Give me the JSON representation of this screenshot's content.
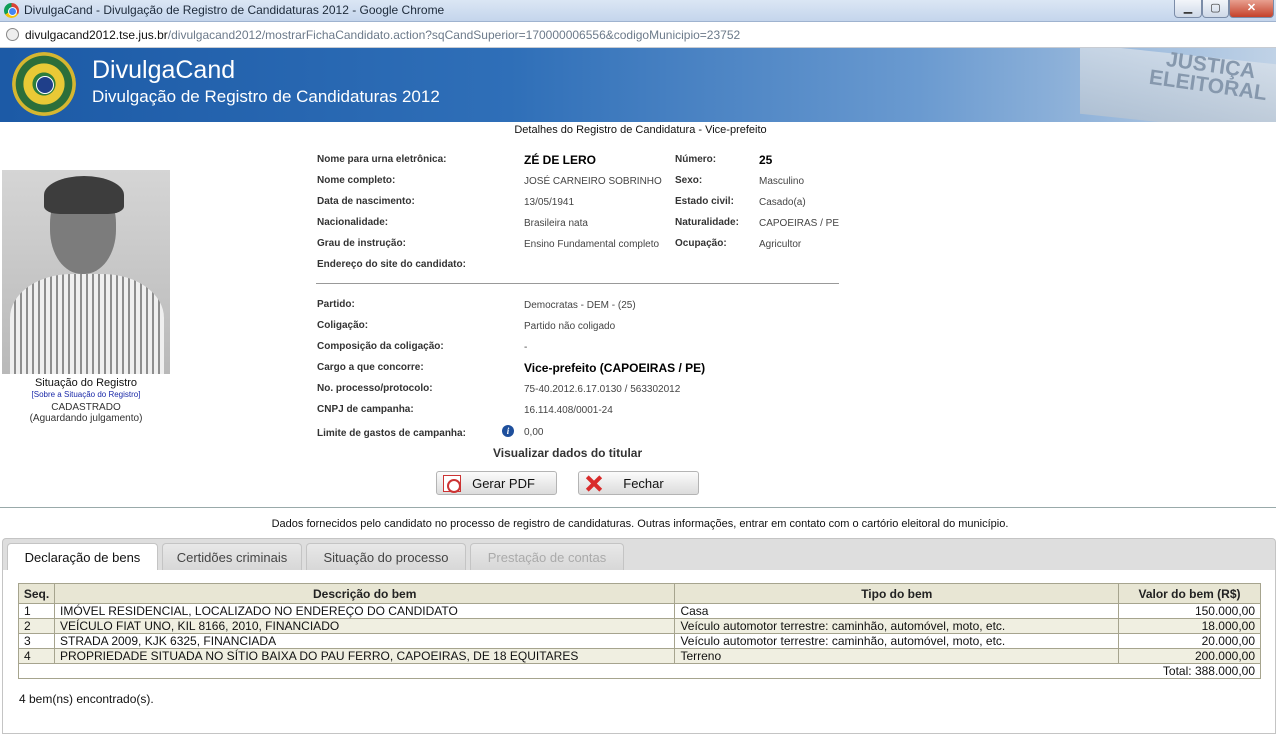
{
  "window": {
    "title": "DivulgaCand - Divulgação de Registro de Candidaturas 2012 - Google Chrome",
    "minimize": "▁",
    "maximize": "▢",
    "close": "✕"
  },
  "address": {
    "host": "divulgacand2012.tse.jus.br",
    "path": "/divulgacand2012/mostrarFichaCandidato.action?sqCandSuperior=170000006556&codigoMunicipio=23752"
  },
  "banner": {
    "brand": "DivulgaCand",
    "subtitle": "Divulgação de Registro de Candidaturas 2012",
    "decoration_text": "JUSTIÇA\nELEITORAL"
  },
  "page_heading": "Detalhes do Registro de Candidatura - Vice-prefeito",
  "registro": {
    "title": "Situação do Registro",
    "link": "[Sobre a Situação do Registro]",
    "status": "CADASTRADO",
    "detail": "(Aguardando julgamento)"
  },
  "candidato": {
    "nome_urna_label": "Nome para urna eletrônica:",
    "nome_urna": "ZÉ DE LERO",
    "numero_label": "Número:",
    "numero": "25",
    "nome_completo_label": "Nome completo:",
    "nome_completo": "JOSÉ CARNEIRO SOBRINHO",
    "sexo_label": "Sexo:",
    "sexo": "Masculino",
    "nascimento_label": "Data de nascimento:",
    "nascimento": "13/05/1941",
    "estado_civil_label": "Estado civil:",
    "estado_civil": "Casado(a)",
    "nacionalidade_label": "Nacionalidade:",
    "nacionalidade": "Brasileira nata",
    "naturalidade_label": "Naturalidade:",
    "naturalidade": "CAPOEIRAS / PE",
    "instrucao_label": "Grau de instrução:",
    "instrucao": "Ensino Fundamental completo",
    "ocupacao_label": "Ocupação:",
    "ocupacao": "Agricultor",
    "site_label": "Endereço do site do candidato:"
  },
  "candidatura": {
    "partido_label": "Partido:",
    "partido": "Democratas - DEM - (25)",
    "coligacao_label": "Coligação:",
    "coligacao": "Partido não coligado",
    "composicao_label": "Composição da coligação:",
    "composicao": "-",
    "cargo_label": "Cargo a que concorre:",
    "cargo": "Vice-prefeito (CAPOEIRAS / PE)",
    "processo_label": "No. processo/protocolo:",
    "processo": "75-40.2012.6.17.0130 / 563302012",
    "cnpj_label": "CNPJ de campanha:",
    "cnpj": "16.114.408/0001-24",
    "limite_label": "Limite de gastos de campanha:",
    "limite_icon": "i",
    "limite": "0,00"
  },
  "visualizar_titular": "Visualizar dados do titular",
  "buttons": {
    "pdf": "Gerar PDF",
    "fechar": "Fechar"
  },
  "notice": "Dados fornecidos pelo candidato no processo de registro de candidaturas.  Outras informações, entrar em contato com o cartório eleitoral do município.",
  "tabs": [
    {
      "label": "Declaração de bens",
      "state": "active"
    },
    {
      "label": "Certidões criminais",
      "state": "normal"
    },
    {
      "label": "Situação do processo",
      "state": "normal"
    },
    {
      "label": "Prestação de contas",
      "state": "disabled"
    }
  ],
  "bens": {
    "headers": [
      "Seq.",
      "Descrição do bem",
      "Tipo do bem",
      "Valor do bem (R$)"
    ],
    "rows": [
      {
        "seq": "1",
        "descricao": "IMÓVEL RESIDENCIAL, LOCALIZADO NO ENDEREÇO DO CANDIDATO",
        "tipo": "Casa",
        "valor": "150.000,00"
      },
      {
        "seq": "2",
        "descricao": "VEÍCULO FIAT UNO, KIL 8166, 2010, FINANCIADO",
        "tipo": "Veículo automotor terrestre: caminhão, automóvel, moto, etc.",
        "valor": "18.000,00"
      },
      {
        "seq": "3",
        "descricao": "STRADA 2009, KJK 6325, FINANCIADA",
        "tipo": "Veículo automotor terrestre: caminhão, automóvel, moto, etc.",
        "valor": "20.000,00"
      },
      {
        "seq": "4",
        "descricao": "PROPRIEDADE SITUADA NO SÍTIO BAIXA DO PAU FERRO, CAPOEIRAS, DE 18 EQUITARES",
        "tipo": "Terreno",
        "valor": "200.000,00"
      }
    ],
    "total": "Total: 388.000,00",
    "found": "4 bem(ns) encontrado(s)."
  }
}
